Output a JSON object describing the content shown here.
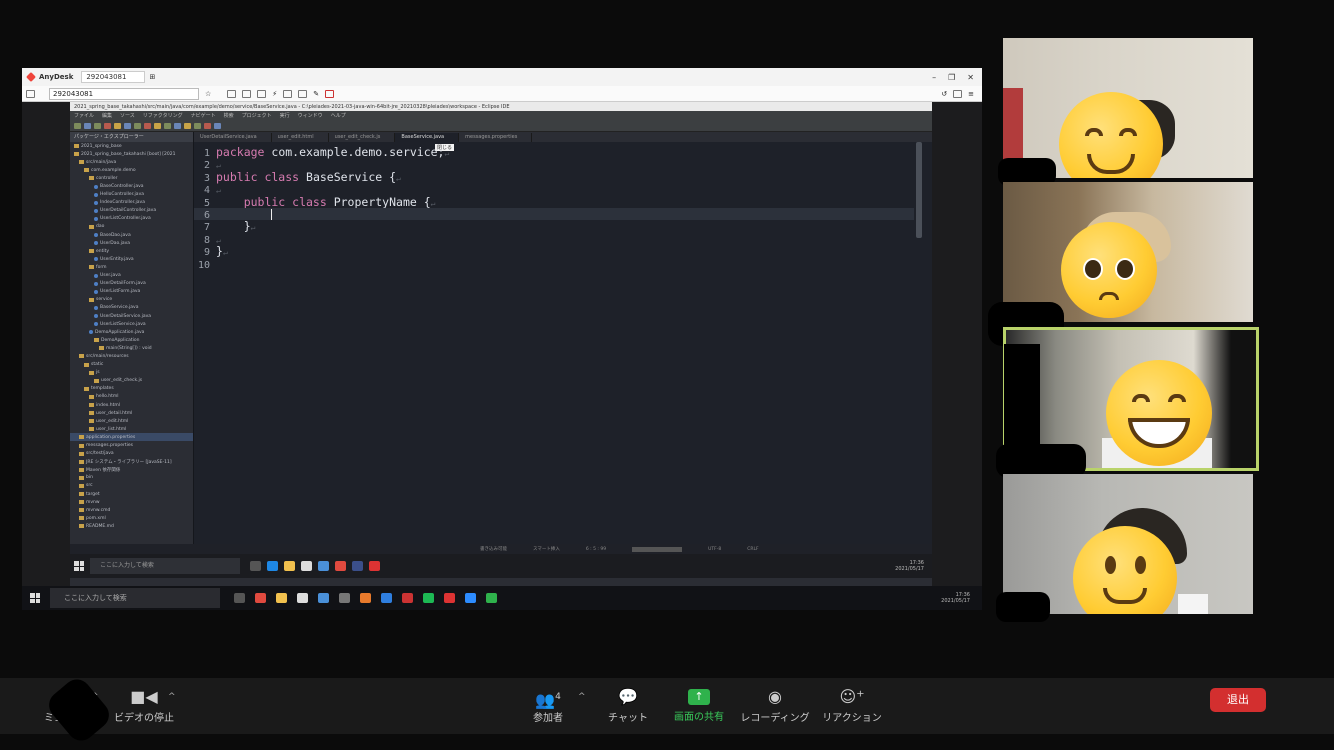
{
  "anydesk": {
    "title": "AnyDesk",
    "tab_id": "292043081",
    "address": "292043081"
  },
  "remote": {
    "eclipse_title": "2021_spring_base_takahashi/src/main/java/com/example/demo/service/BaseService.java - C:\\pleiades-2021-03-java-win-64bit-jre_20210328\\pleiades\\workspace - Eclipse IDE",
    "menu": [
      "ファイル",
      "編集",
      "ソース",
      "リファクタリング",
      "ナビゲート",
      "検索",
      "プロジェクト",
      "実行",
      "ウィンドウ",
      "ヘルプ"
    ],
    "explorer_title": "パッケージ・エクスプローラー",
    "tree": [
      "2021_spring_base",
      "2021_spring_base_takahashi [boot] [2021",
      "src/main/java",
      "com.example.demo",
      "controller",
      "BaseController.java",
      "HelloController.java",
      "IndexController.java",
      "UserDetailController.java",
      "UserListController.java",
      "dao",
      "BaseDao.java",
      "UserDao.java",
      "entity",
      "UserEntity.java",
      "form",
      "User.java",
      "UserDetailForm.java",
      "UserListForm.java",
      "service",
      "BaseService.java",
      "UserDetailService.java",
      "UserListService.java",
      "DemoApplication.java",
      "DemoApplication",
      "main(String[]) : void",
      "src/main/resources",
      "static",
      "js",
      "user_edit_check.js",
      "templates",
      "hello.html",
      "index.html",
      "user_detail.html",
      "user_edit.html",
      "user_list.html",
      "application.properties",
      "messages.properties",
      "src/test/java",
      "JRE システム・ライブラリー [JavaSE-11]",
      "Maven 依存関係",
      "bin",
      "src",
      "target",
      "mvnw",
      "mvnw.cmd",
      "pom.xml",
      "README.md"
    ],
    "editor_tabs": [
      "UserDetailService.java",
      "user_edit.html",
      "user_edit_check.js",
      "BaseService.java",
      "messages.properties"
    ],
    "tooltip": "閉じる",
    "code_lines": [
      {
        "num": "1",
        "kw": "package",
        "text": " com.example.demo.service;",
        "tail": "↵"
      },
      {
        "num": "2",
        "kw": "",
        "text": "",
        "tail": "↵"
      },
      {
        "num": "3",
        "kw": "public class",
        "text": " BaseService {",
        "tail": "↵"
      },
      {
        "num": "4",
        "kw": "",
        "text": "",
        "tail": "↵"
      },
      {
        "num": "5",
        "kw": "    public class",
        "text": " PropertyName {",
        "tail": "↵"
      },
      {
        "num": "6",
        "kw": "",
        "text": "        ",
        "tail": ""
      },
      {
        "num": "7",
        "kw": "",
        "text": "    }",
        "tail": "↵"
      },
      {
        "num": "8",
        "kw": "",
        "text": "",
        "tail": "↵"
      },
      {
        "num": "9",
        "kw": "",
        "text": "}",
        "tail": "↵"
      },
      {
        "num": "10",
        "kw": "",
        "text": "",
        "tail": ""
      }
    ],
    "status": [
      "書き込み可能",
      "スマート挿入",
      "6 : 5 : 99",
      "",
      "UTF-8",
      "CRLF"
    ],
    "search_placeholder": "ここに入力して検索",
    "clock": {
      "time": "17:36",
      "date": "2021/05/17"
    }
  },
  "host": {
    "search_placeholder": "ここに入力して検索",
    "clock": {
      "time": "17:36",
      "date": "2021/05/17"
    }
  },
  "toolbar": {
    "mute_label": "ミュート",
    "video_label": "ビデオの停止",
    "participants_label": "参加者",
    "participants_count": "4",
    "chat_label": "チャット",
    "share_label": "画面の共有",
    "record_label": "レコーディング",
    "reaction_label": "リアクション",
    "leave_label": "退出"
  },
  "colors": {
    "share_green": "#2fb24c",
    "leave_red": "#d32f2f",
    "active_speaker": "#b9d36a"
  }
}
